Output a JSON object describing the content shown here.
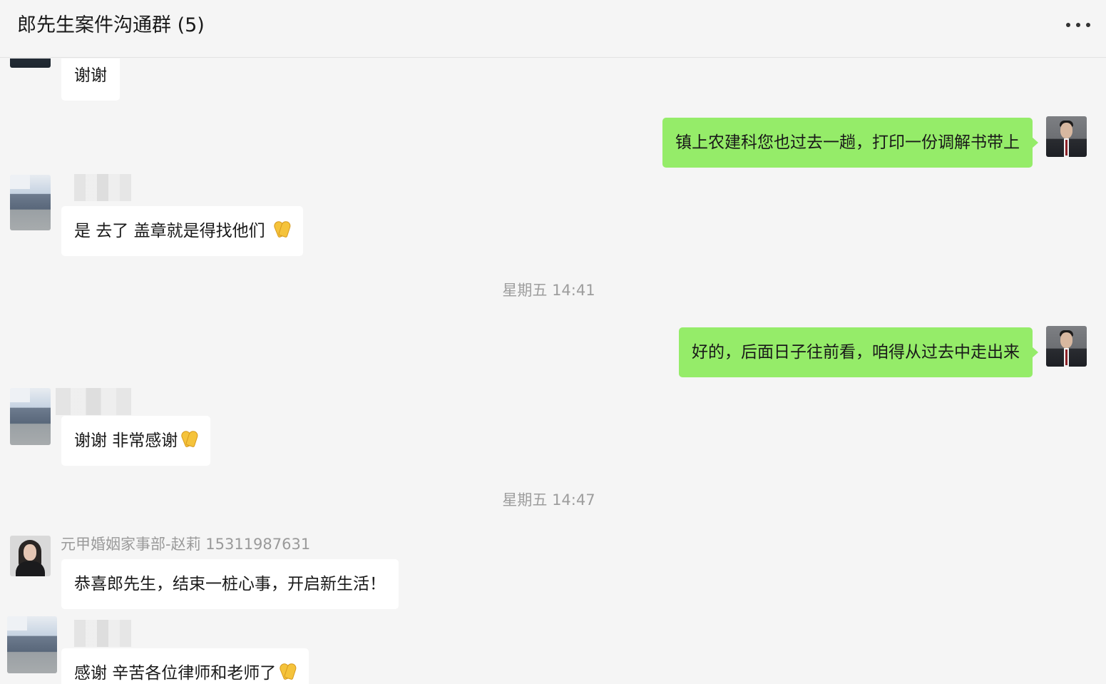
{
  "header": {
    "title": "郎先生案件沟通群 (5)",
    "more_icon": "more-horizontal-icon"
  },
  "messages": [
    {
      "side": "in",
      "sender": "",
      "text": "谢谢",
      "emoji": false
    },
    {
      "side": "out",
      "text": "镇上农建科您也过去一趟，打印一份调解书带上"
    },
    {
      "side": "in",
      "sender": "",
      "text": "是 去了 盖章就是得找他们 ",
      "emoji": "folded-hands-icon"
    },
    {
      "type": "time",
      "text": "星期五 14:41"
    },
    {
      "side": "out",
      "text": "好的，后面日子往前看，咱得从过去中走出来"
    },
    {
      "side": "in",
      "sender": "",
      "text": "谢谢 非常感谢",
      "emoji": "folded-hands-icon"
    },
    {
      "type": "time",
      "text": "星期五 14:47"
    },
    {
      "side": "in",
      "sender": "元甲婚姻家事部-赵莉 15311987631",
      "text": "恭喜郎先生，结束一桩心事，开启新生活！"
    },
    {
      "side": "in",
      "sender": "",
      "text": "感谢 辛苦各位律师和老师了",
      "emoji": "folded-hands-icon"
    }
  ]
}
